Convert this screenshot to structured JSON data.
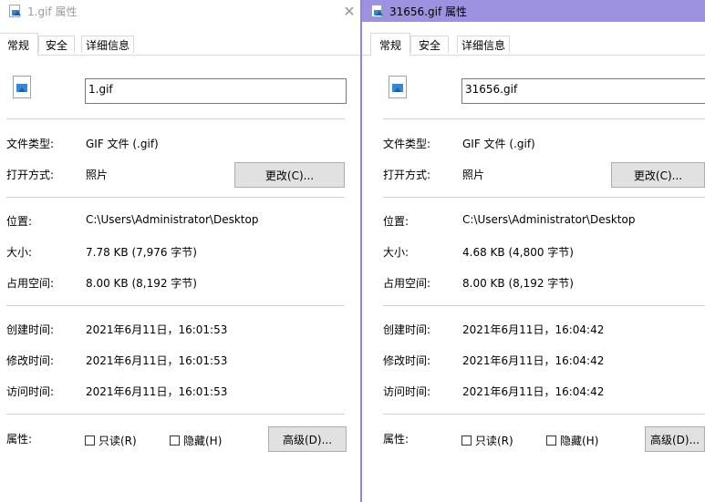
{
  "windows": [
    {
      "title": "1.gif 属性",
      "tabs": [
        "常规",
        "安全",
        "详细信息"
      ],
      "file_name": "1.gif",
      "rows": {
        "type_label": "文件类型:",
        "type_value": "GIF 文件 (.gif)",
        "open_label": "打开方式:",
        "open_value": "照片",
        "change_button": "更改(C)...",
        "location_label": "位置:",
        "location_value": "C:\\Users\\Administrator\\Desktop",
        "size_label": "大小:",
        "size_value": "7.78 KB (7,976 字节)",
        "disk_label": "占用空间:",
        "disk_value": "8.00 KB (8,192 字节)",
        "created_label": "创建时间:",
        "created_value": "2021年6月11日，16:01:53",
        "modified_label": "修改时间:",
        "modified_value": "2021年6月11日，16:01:53",
        "accessed_label": "访问时间:",
        "accessed_value": "2021年6月11日，16:01:53",
        "attr_label": "属性:",
        "readonly_label": "只读(R)",
        "hidden_label": "隐藏(H)",
        "advanced_button": "高级(D)..."
      },
      "close_icon": "✕"
    },
    {
      "title": "31656.gif 属性",
      "tabs": [
        "常规",
        "安全",
        "详细信息"
      ],
      "file_name": "31656.gif",
      "rows": {
        "type_label": "文件类型:",
        "type_value": "GIF 文件 (.gif)",
        "open_label": "打开方式:",
        "open_value": "照片",
        "change_button": "更改(C)...",
        "location_label": "位置:",
        "location_value": "C:\\Users\\Administrator\\Desktop",
        "size_label": "大小:",
        "size_value": "4.68 KB (4,800 字节)",
        "disk_label": "占用空间:",
        "disk_value": "8.00 KB (8,192 字节)",
        "created_label": "创建时间:",
        "created_value": "2021年6月11日，16:04:42",
        "modified_label": "修改时间:",
        "modified_value": "2021年6月11日，16:04:42",
        "accessed_label": "访问时间:",
        "accessed_value": "2021年6月11日，16:04:42",
        "attr_label": "属性:",
        "readonly_label": "只读(R)",
        "hidden_label": "隐藏(H)",
        "advanced_button": "高级(D)..."
      }
    }
  ],
  "colors": {
    "active_title_bar": "#9d92e0",
    "button_face": "#e1e1e1"
  }
}
